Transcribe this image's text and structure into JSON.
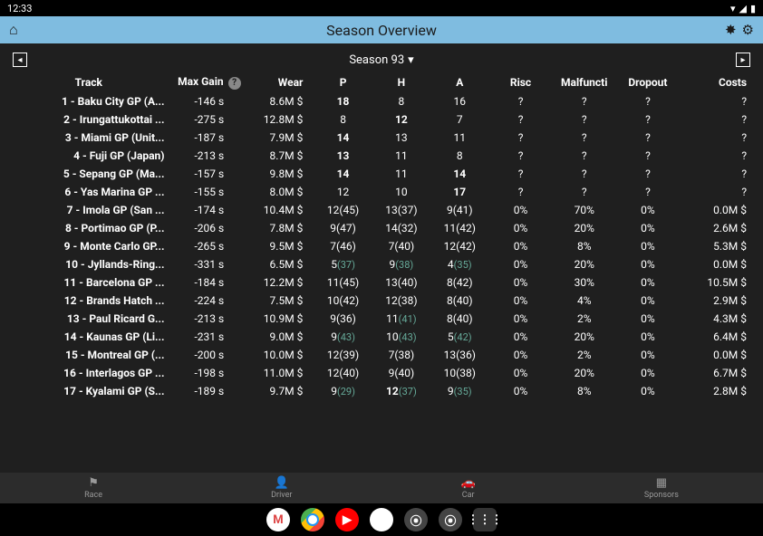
{
  "status": {
    "time": "12:33"
  },
  "header": {
    "title": "Season Overview"
  },
  "season_nav": {
    "label": "Season 93"
  },
  "columns": {
    "track": "Track",
    "maxgain": "Max Gain",
    "wear": "Wear",
    "p": "P",
    "h": "H",
    "a": "A",
    "risc": "Risc",
    "malfuncti": "Malfuncti",
    "dropout": "Dropout",
    "costs": "Costs"
  },
  "rows": [
    {
      "track": "1 - Baku City GP (A...",
      "maxgain": "-146 s",
      "wear": "8.6M $",
      "p": "18",
      "h": "8",
      "a": "16",
      "bold": "p",
      "risc": "?",
      "malf": "?",
      "drop": "?",
      "costs": "?"
    },
    {
      "track": "2 - Irungattukottai ...",
      "maxgain": "-275 s",
      "wear": "12.8M $",
      "p": "8",
      "h": "12",
      "a": "7",
      "bold": "h",
      "risc": "?",
      "malf": "?",
      "drop": "?",
      "costs": "?"
    },
    {
      "track": "3 - Miami GP (Unit...",
      "maxgain": "-187 s",
      "wear": "7.9M $",
      "p": "14",
      "h": "13",
      "a": "11",
      "bold": "p",
      "risc": "?",
      "malf": "?",
      "drop": "?",
      "costs": "?"
    },
    {
      "track": "4 - Fuji GP (Japan)",
      "maxgain": "-213 s",
      "wear": "8.7M $",
      "p": "13",
      "h": "11",
      "a": "8",
      "bold": "p",
      "risc": "?",
      "malf": "?",
      "drop": "?",
      "costs": "?"
    },
    {
      "track": "5 - Sepang GP (Ma...",
      "maxgain": "-157 s",
      "wear": "9.8M $",
      "p": "14",
      "h": "11",
      "a": "14",
      "bold": "pa",
      "risc": "?",
      "malf": "?",
      "drop": "?",
      "costs": "?"
    },
    {
      "track": "6 - Yas Marina GP ...",
      "maxgain": "-155 s",
      "wear": "8.0M $",
      "p": "12",
      "h": "10",
      "a": "17",
      "bold": "a",
      "risc": "?",
      "malf": "?",
      "drop": "?",
      "costs": "?"
    },
    {
      "track": "7 - Imola GP (San ...",
      "maxgain": "-174 s",
      "wear": "10.4M $",
      "p": "12(45)",
      "h": "13(37)",
      "a": "9(41)",
      "risc": "0%",
      "malf": "70%",
      "drop": "0%",
      "costs": "0.0M $"
    },
    {
      "track": "8 - Portimao GP (P...",
      "maxgain": "-206 s",
      "wear": "7.8M $",
      "p": "9(47)",
      "h": "14(32)",
      "a": "11(42)",
      "risc": "0%",
      "malf": "20%",
      "drop": "0%",
      "costs": "2.6M $"
    },
    {
      "track": "9 - Monte Carlo GP...",
      "maxgain": "-265 s",
      "wear": "9.5M $",
      "p": "7(46)",
      "h": "7(40)",
      "a": "12(42)",
      "risc": "0%",
      "malf": "8%",
      "drop": "0%",
      "costs": "5.3M $"
    },
    {
      "track": "10 - Jyllands-Ring...",
      "maxgain": "-331 s",
      "wear": "6.5M $",
      "p": "5",
      "psub": "(37)",
      "h": "9",
      "hsub": "(38)",
      "a": "4",
      "asub": "(35)",
      "risc": "0%",
      "malf": "20%",
      "drop": "0%",
      "costs": "0.0M $"
    },
    {
      "track": "11 - Barcelona GP ...",
      "maxgain": "-184 s",
      "wear": "12.2M $",
      "p": "11(45)",
      "h": "13(40)",
      "a": "8(42)",
      "risc": "0%",
      "malf": "30%",
      "drop": "0%",
      "costs": "10.5M $"
    },
    {
      "track": "12 - Brands Hatch ...",
      "maxgain": "-224 s",
      "wear": "7.5M $",
      "p": "10(42)",
      "h": "12(38)",
      "a": "8(40)",
      "risc": "0%",
      "malf": "4%",
      "drop": "0%",
      "costs": "2.9M $"
    },
    {
      "track": "13 - Paul Ricard G...",
      "maxgain": "-213 s",
      "wear": "10.9M $",
      "p": "9(36)",
      "h": "11",
      "hsub": "(41)",
      "a": "8(40)",
      "risc": "0%",
      "malf": "2%",
      "drop": "0%",
      "costs": "4.3M $"
    },
    {
      "track": "14 - Kaunas GP (Li...",
      "maxgain": "-231 s",
      "wear": "9.0M $",
      "p": "9",
      "psub": "(43)",
      "h": "10",
      "hsub": "(43)",
      "a": "5",
      "asub": "(42)",
      "risc": "0%",
      "malf": "20%",
      "drop": "0%",
      "costs": "6.4M $"
    },
    {
      "track": "15 - Montreal GP (...",
      "maxgain": "-200 s",
      "wear": "10.0M $",
      "p": "12(39)",
      "h": "7(38)",
      "a": "13(36)",
      "risc": "0%",
      "malf": "2%",
      "drop": "0%",
      "costs": "0.0M $"
    },
    {
      "track": "16 - Interlagos GP ...",
      "maxgain": "-198 s",
      "wear": "11.0M $",
      "p": "12(40)",
      "h": "9(40)",
      "a": "10(38)",
      "risc": "0%",
      "malf": "20%",
      "drop": "0%",
      "costs": "6.7M $"
    },
    {
      "track": "17 - Kyalami GP (S...",
      "maxgain": "-189 s",
      "wear": "9.7M $",
      "p": "9",
      "psub": "(29)",
      "h": "12",
      "hsub": "(37)",
      "hbold": true,
      "a": "9",
      "asub": "(35)",
      "risc": "0%",
      "malf": "8%",
      "drop": "0%",
      "costs": "2.8M $"
    }
  ],
  "bottom_nav": {
    "race": "Race",
    "driver": "Driver",
    "car": "Car",
    "sponsors": "Sponsors"
  }
}
